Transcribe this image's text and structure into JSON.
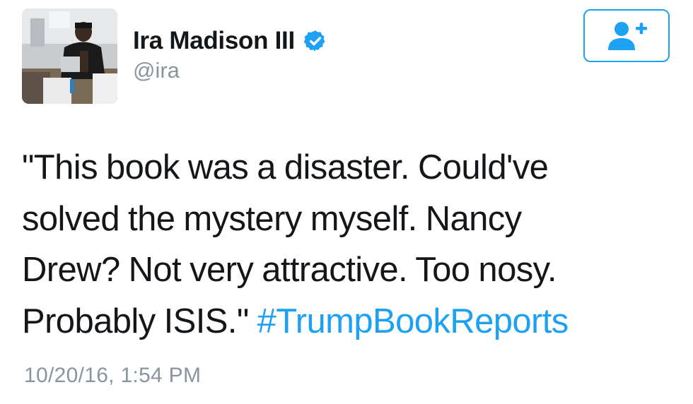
{
  "user": {
    "display_name": "Ira Madison III",
    "handle": "@ira",
    "verified": true,
    "avatar_icon": "profile-photo"
  },
  "follow_button": {
    "icon": "add-user-icon",
    "color": "#1da1f2"
  },
  "tweet": {
    "lines": [
      "\"This book was a disaster. Could've",
      "solved the mystery myself. Nancy",
      "Drew? Not very attractive. Too nosy.",
      "Probably ISIS.\" "
    ],
    "hashtag": "#TrumpBookReports",
    "hashtag_color": "#1da1f2",
    "timestamp": "10/20/16, 1:54 PM"
  }
}
